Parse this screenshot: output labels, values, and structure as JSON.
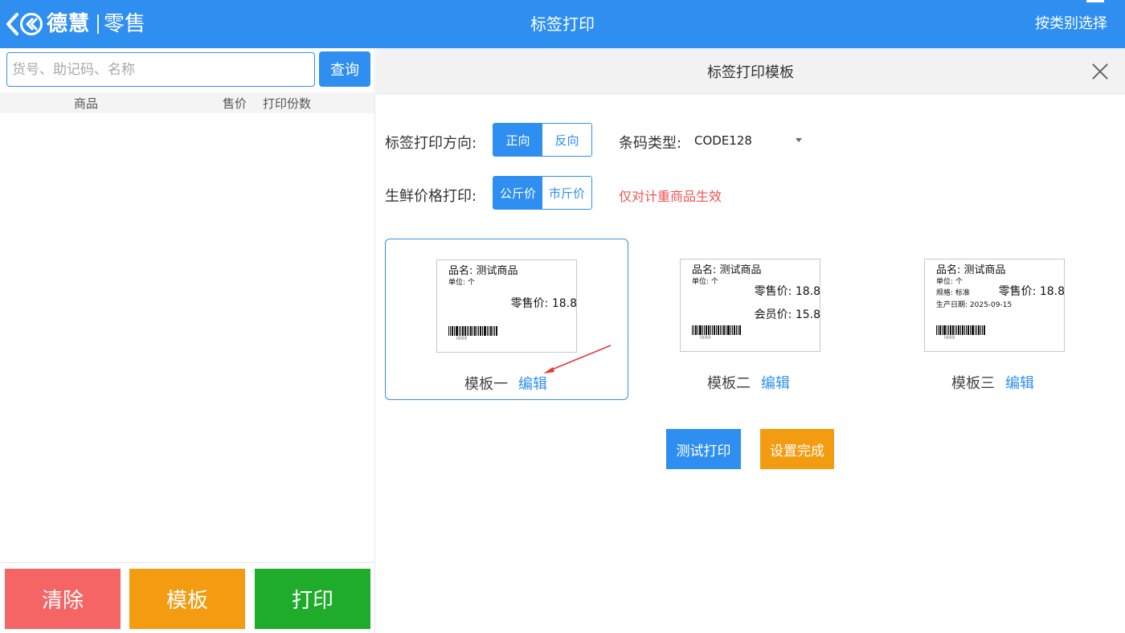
{
  "topbar": {
    "brand": "德慧",
    "subbrand": "零售",
    "title": "标签打印",
    "category_select": "按类别选择"
  },
  "left": {
    "search": {
      "placeholder": "货号、助记码、名称",
      "value": "",
      "button": "查询"
    },
    "columns": [
      "商品",
      "售价",
      "打印份数"
    ],
    "actions": {
      "clear": "清除",
      "template": "模板",
      "print": "打印"
    }
  },
  "dialog": {
    "title": "标签打印模板",
    "direction": {
      "label": "标签打印方向:",
      "options": [
        "正向",
        "反向"
      ],
      "selected": "正向"
    },
    "barcode": {
      "label": "条码类型:",
      "value": "CODE128"
    },
    "fresh_price": {
      "label": "生鲜价格打印:",
      "options": [
        "公斤价",
        "市斤价"
      ],
      "selected": "公斤价"
    },
    "fresh_note": "仅对计重商品生效",
    "templates": [
      {
        "name": "模板一",
        "edit": "编辑",
        "selected": true,
        "preview": {
          "product": "品名: 测试商品",
          "unit": "单位: 个",
          "retail_price": "零售价: 18.8"
        }
      },
      {
        "name": "模板二",
        "edit": "编辑",
        "selected": false,
        "preview": {
          "product": "品名: 测试商品",
          "unit": "单位: 个",
          "retail_price": "零售价: 18.8",
          "member_price": "会员价: 15.8"
        }
      },
      {
        "name": "模板三",
        "edit": "编辑",
        "selected": false,
        "preview": {
          "product": "品名: 测试商品",
          "unit": "单位: 个",
          "spec": "规格: 标准",
          "retail_price": "零售价: 18.8",
          "production_date": "生产日期: 2025-09-15"
        }
      }
    ],
    "buttons": {
      "test_print": "测试打印",
      "done": "设置完成"
    }
  },
  "colors": {
    "primary": "#2f8ff1",
    "orange": "#f39c12",
    "red": "#f56565",
    "green": "#1fac2a",
    "note_red": "#f05454"
  }
}
